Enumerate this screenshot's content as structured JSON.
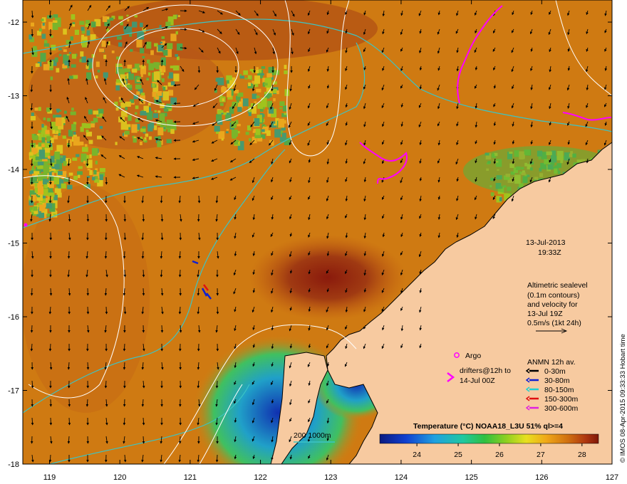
{
  "map": {
    "lon_ticks": [
      "119",
      "120",
      "121",
      "122",
      "123",
      "124",
      "125",
      "126",
      "127"
    ],
    "lat_ticks": [
      "-12",
      "-13",
      "-14",
      "-15",
      "-16",
      "-17",
      "-18"
    ],
    "lon_range": [
      118.62,
      127.0
    ],
    "lat_range": [
      -18.0,
      -11.7
    ]
  },
  "timestamp": {
    "date": "13-Jul-2013",
    "time": "19:33Z"
  },
  "altimetry": {
    "lines": [
      "Altimetric sealevel",
      "(0.1m contours)",
      "and velocity for",
      "13-Jul 19Z",
      "0.5m/s (1kt 24h)"
    ]
  },
  "argo_label": "Argo",
  "drifters_label": [
    "drifters@12h to",
    "14-Jul 00Z"
  ],
  "anmn": {
    "title": "ANMN 12h av.",
    "items": [
      {
        "label": "0-30m",
        "color": "#000000"
      },
      {
        "label": "30-80m",
        "color": "#1020d0"
      },
      {
        "label": "80-150m",
        "color": "#20d0d0"
      },
      {
        "label": "150-300m",
        "color": "#e01010"
      },
      {
        "label": "300-600m",
        "color": "#e020e0"
      }
    ]
  },
  "colorbar": {
    "title": "Temperature (°C) NOAA18_L3U 51% ql>=4",
    "ticks": [
      "24",
      "25",
      "26",
      "27",
      "28"
    ],
    "range": [
      23.1,
      28.4
    ]
  },
  "scale_label": "200  1000m",
  "credit": "© IMOS 08-Apr-2015 09:33:33 Hobart time",
  "colors": {
    "sst_warm": "#d07c10",
    "sst_hot": "#9c2a10",
    "land": "#f7caa0",
    "isobath": "#3cc4c4",
    "drifter": "#ff00ff",
    "contour": "#ffffff"
  }
}
